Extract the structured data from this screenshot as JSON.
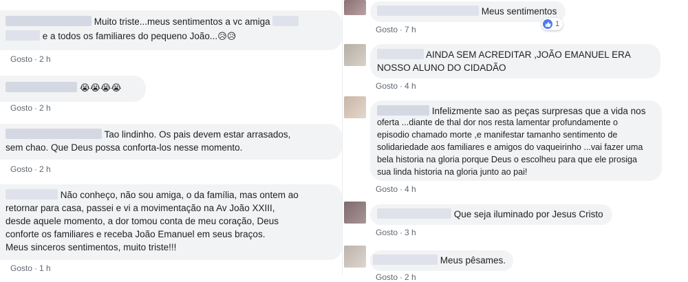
{
  "meta_label": "Gosto",
  "left": [
    {
      "text_line1": "Muito triste...meus sentimentos a vc amiga",
      "text_line2": "e a todos os familiares do pequeno João...",
      "emoji": "😥😥",
      "time": "2 h"
    },
    {
      "emoji": "😭😭😭😭",
      "time": "2 h"
    },
    {
      "text_line1": "Tao lindinho. Os pais devem estar arrasados,",
      "text_line2": "sem chao. Que Deus possa conforta-los nesse momento.",
      "time": "2 h"
    },
    {
      "text_line1": "Não conheço, não sou amiga, o da família, mas ontem ao",
      "text_line2": "retornar para casa, passei e vi a movimentação na Av João XXIII,",
      "text_line3": "desde aquele momento, a dor tomou conta de meu coração, Deus",
      "text_line4": "conforte os familiares e receba João Emanuel em seus braços.",
      "text_line5": "Meus sinceros sentimentos, muito triste!!!",
      "time": "1 h"
    }
  ],
  "right": [
    {
      "text": "Meus sentimentos",
      "time": "7 h",
      "reaction_count": "1"
    },
    {
      "text_line1": "AINDA SEM ACREDITAR ,JOÃO EMANUEL ERA",
      "text_line2": "NOSSO ALUNO DO CIDADÃO",
      "time": "4 h"
    },
    {
      "text_line1": "Infelizmente sao as peças surpresas que a vida nos",
      "text_line2": "oferta ...diante de thal dor nos resta lamentar profundamente o",
      "text_line3": "episodio chamado morte ,e manifestar tamanho sentimento de",
      "text_line4": "solidariedade aos familiares e amigos do vaqueirinho ...vai fazer uma",
      "text_line5": "bela historia na gloria porque Deus o escolheu para que ele prosiga",
      "text_line6": "sua linda historia na gloria junto ao pai!",
      "time": "4 h"
    },
    {
      "text": "Que seja iluminado por Jesus Cristo",
      "time": "3 h"
    },
    {
      "text": "Meus pêsames.",
      "time": "2 h"
    }
  ],
  "colors": {
    "bubble": "#f2f3f5",
    "meta_text": "#606770",
    "like_blue": "#4a7cf0"
  }
}
